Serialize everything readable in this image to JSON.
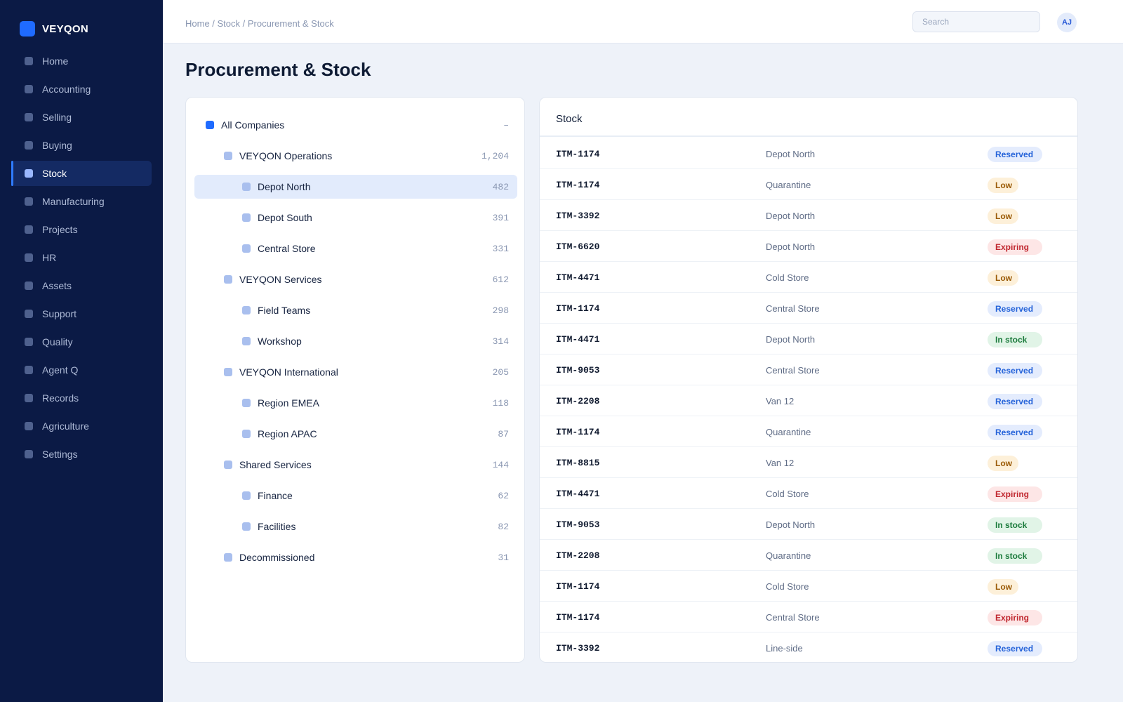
{
  "brand": {
    "name": "VEYQON"
  },
  "nav": {
    "items": [
      {
        "label": "Home",
        "active": false
      },
      {
        "label": "Accounting",
        "active": false
      },
      {
        "label": "Selling",
        "active": false
      },
      {
        "label": "Buying",
        "active": false
      },
      {
        "label": "Stock",
        "active": true
      },
      {
        "label": "Manufacturing",
        "active": false
      },
      {
        "label": "Projects",
        "active": false
      },
      {
        "label": "HR",
        "active": false
      },
      {
        "label": "Assets",
        "active": false
      },
      {
        "label": "Support",
        "active": false
      },
      {
        "label": "Quality",
        "active": false
      },
      {
        "label": "Agent Q",
        "active": false
      },
      {
        "label": "Records",
        "active": false
      },
      {
        "label": "Agriculture",
        "active": false
      },
      {
        "label": "Settings",
        "active": false
      }
    ]
  },
  "topbar": {
    "breadcrumb": "Home / Stock / Procurement & Stock",
    "search_placeholder": "Search",
    "avatar_initials": "AJ"
  },
  "page": {
    "title": "Procurement & Stock"
  },
  "tree": {
    "items": [
      {
        "label": "All Companies",
        "count": "–",
        "level": 0,
        "selected": false
      },
      {
        "label": "VEYQON Operations",
        "count": "1,204",
        "level": 1,
        "selected": false
      },
      {
        "label": "Depot North",
        "count": "482",
        "level": 2,
        "selected": true
      },
      {
        "label": "Depot South",
        "count": "391",
        "level": 2,
        "selected": false
      },
      {
        "label": "Central Store",
        "count": "331",
        "level": 2,
        "selected": false
      },
      {
        "label": "VEYQON Services",
        "count": "612",
        "level": 1,
        "selected": false
      },
      {
        "label": "Field Teams",
        "count": "298",
        "level": 2,
        "selected": false
      },
      {
        "label": "Workshop",
        "count": "314",
        "level": 2,
        "selected": false
      },
      {
        "label": "VEYQON International",
        "count": "205",
        "level": 1,
        "selected": false
      },
      {
        "label": "Region EMEA",
        "count": "118",
        "level": 2,
        "selected": false
      },
      {
        "label": "Region APAC",
        "count": "87",
        "level": 2,
        "selected": false
      },
      {
        "label": "Shared Services",
        "count": "144",
        "level": 1,
        "selected": false
      },
      {
        "label": "Finance",
        "count": "62",
        "level": 2,
        "selected": false
      },
      {
        "label": "Facilities",
        "count": "82",
        "level": 2,
        "selected": false
      },
      {
        "label": "Decommissioned",
        "count": "31",
        "level": 1,
        "selected": false
      }
    ]
  },
  "stock": {
    "title": "Stock",
    "rows": [
      {
        "code": "ITM-1174",
        "location": "Depot North",
        "status": "Reserved"
      },
      {
        "code": "ITM-1174",
        "location": "Quarantine",
        "status": "Low"
      },
      {
        "code": "ITM-3392",
        "location": "Depot North",
        "status": "Low"
      },
      {
        "code": "ITM-6620",
        "location": "Depot North",
        "status": "Expiring"
      },
      {
        "code": "ITM-4471",
        "location": "Cold Store",
        "status": "Low"
      },
      {
        "code": "ITM-1174",
        "location": "Central Store",
        "status": "Reserved"
      },
      {
        "code": "ITM-4471",
        "location": "Depot North",
        "status": "In stock"
      },
      {
        "code": "ITM-9053",
        "location": "Central Store",
        "status": "Reserved"
      },
      {
        "code": "ITM-2208",
        "location": "Van 12",
        "status": "Reserved"
      },
      {
        "code": "ITM-1174",
        "location": "Quarantine",
        "status": "Reserved"
      },
      {
        "code": "ITM-8815",
        "location": "Van 12",
        "status": "Low"
      },
      {
        "code": "ITM-4471",
        "location": "Cold Store",
        "status": "Expiring"
      },
      {
        "code": "ITM-9053",
        "location": "Depot North",
        "status": "In stock"
      },
      {
        "code": "ITM-2208",
        "location": "Quarantine",
        "status": "In stock"
      },
      {
        "code": "ITM-1174",
        "location": "Cold Store",
        "status": "Low"
      },
      {
        "code": "ITM-1174",
        "location": "Central Store",
        "status": "Expiring"
      },
      {
        "code": "ITM-3392",
        "location": "Line-side",
        "status": "Reserved"
      }
    ]
  }
}
